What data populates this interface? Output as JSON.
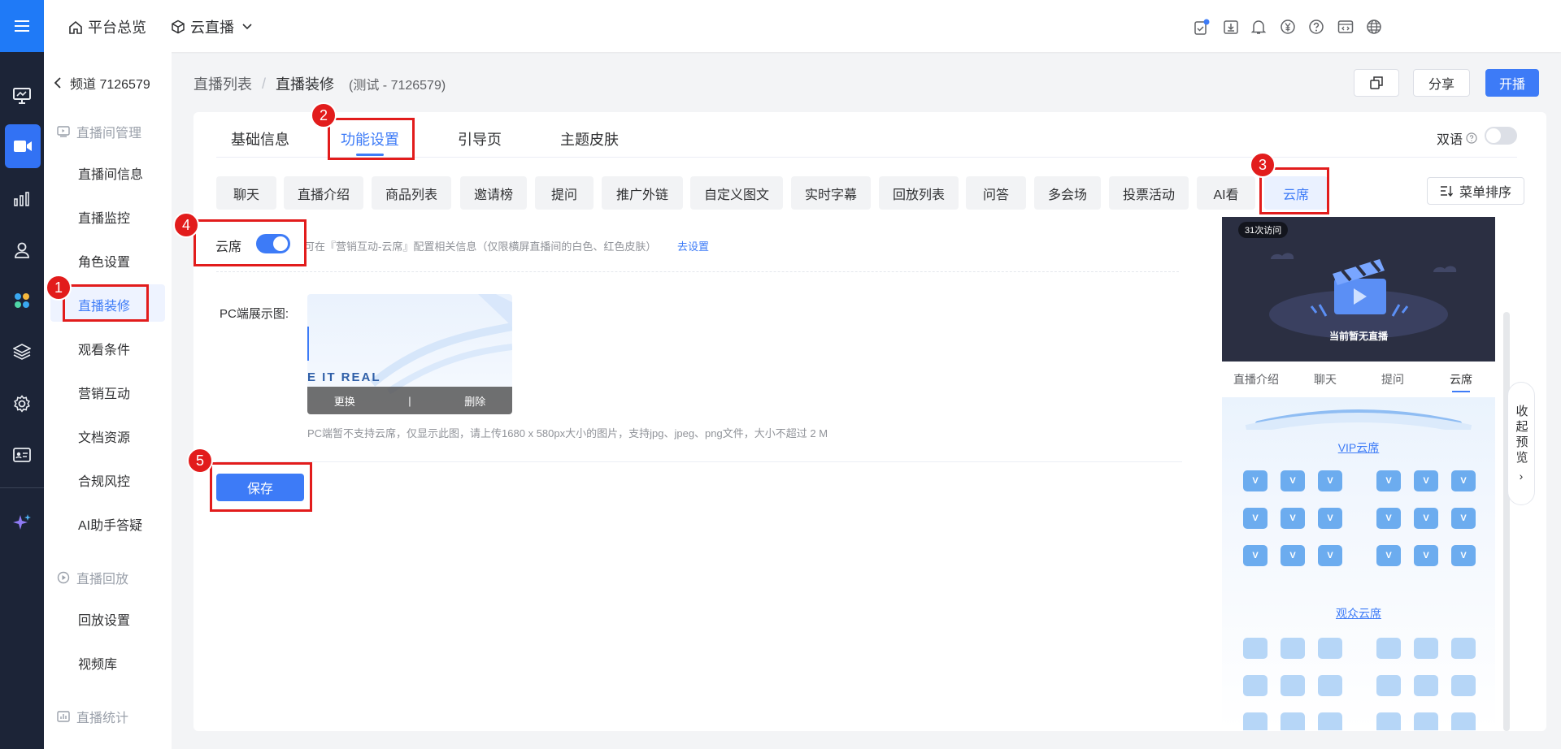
{
  "topbar": {
    "home": "平台总览",
    "product": "云直播"
  },
  "sidebar": {
    "back": "频道 7126579",
    "group1": "直播间管理",
    "items1": [
      "直播间信息",
      "直播监控",
      "角色设置",
      "直播装修",
      "观看条件",
      "营销互动",
      "文档资源",
      "合规风控",
      "AI助手答疑"
    ],
    "group2": "直播回放",
    "items2": [
      "回放设置",
      "视频库"
    ],
    "group3": "直播统计"
  },
  "breadcrumb": {
    "list": "直播列表",
    "sep": "/",
    "current": "直播装修",
    "test": "(测试 - 7126579)"
  },
  "header": {
    "share": "分享",
    "start": "开播"
  },
  "tabs": [
    "基础信息",
    "功能设置",
    "引导页",
    "主题皮肤"
  ],
  "bilingual": "双语",
  "chips": [
    "聊天",
    "直播介绍",
    "商品列表",
    "邀请榜",
    "提问",
    "推广外链",
    "自定义图文",
    "实时字幕",
    "回放列表",
    "问答",
    "多会场",
    "投票活动",
    "AI看",
    "云席"
  ],
  "sort_btn": "菜单排序",
  "cloud_seat": {
    "label": "云席",
    "desc": "可在『营销互动-云席』配置相关信息（仅限横屏直播间的白色、红色皮肤）",
    "link": "去设置",
    "pc_label": "PC端展示图:",
    "img_text": "E IT REAL",
    "replace": "更换",
    "divider": "|",
    "delete": "删除",
    "hint": "PC端暂不支持云席，仅显示此图，请上传1680 x 580px大小的图片，支持jpg、jpeg、png文件，大小不超过 2 M",
    "save": "保存"
  },
  "annotations": [
    "1",
    "2",
    "3",
    "4",
    "5"
  ],
  "preview": {
    "visits": "31次访问",
    "no_live": "当前暂无直播",
    "tabs": [
      "直播介绍",
      "聊天",
      "提问",
      "云席"
    ],
    "vip": "VIP云席",
    "audience": "观众云席",
    "seat_letter": "V",
    "collapse": "收起预览",
    "collapse_arrow": "›"
  },
  "colors": {
    "accent": "#3d7bf7",
    "rail": "#1c2437",
    "annotation": "#e21c1c"
  }
}
